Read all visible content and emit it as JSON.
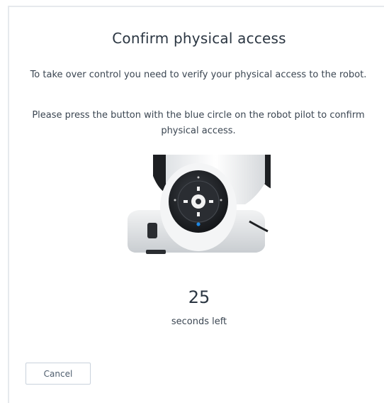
{
  "dialog": {
    "title": "Confirm physical access",
    "paragraph_1": "To take over control you need to verify your physical access to the robot.",
    "paragraph_2": "Please press the button with the blue circle on the robot pilot to confirm physical access.",
    "robot_image_icon": "robot-pilot-image",
    "countdown": {
      "value": "25",
      "label": "seconds left"
    },
    "cancel_label": "Cancel"
  },
  "colors": {
    "title_text": "#2b3642",
    "body_text": "#3b4652",
    "button_border": "#c9d2dc",
    "pilot_dark": "#23262b",
    "pilot_blue_circle": "#1e88e5"
  }
}
